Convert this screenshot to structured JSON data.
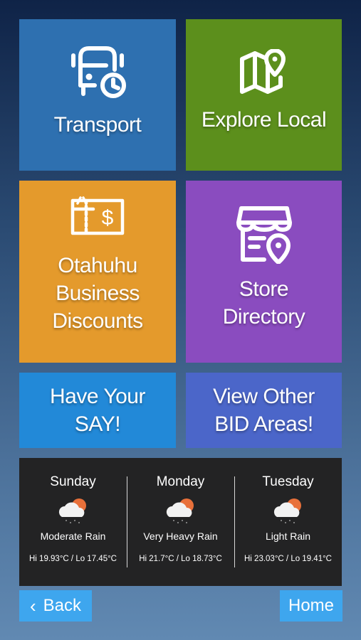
{
  "tiles": {
    "transport": {
      "label": "Transport",
      "color": "#2e70b0",
      "icon": "bus-clock-icon"
    },
    "explore": {
      "label": "Explore Local",
      "color": "#5c8f1c",
      "icon": "map-pin-icon"
    },
    "discounts": {
      "label": "Otahuhu\nBusiness\nDiscounts",
      "color": "#e49a2c",
      "icon": "voucher-dollar-icon"
    },
    "store": {
      "label": "Store\nDirectory",
      "color": "#8a4cbf",
      "icon": "store-pin-icon"
    },
    "say": {
      "label": "Have Your\nSAY!",
      "color": "#2289d8"
    },
    "bid": {
      "label": "View Other\nBID Areas!",
      "color": "#4b66c9"
    }
  },
  "weather": {
    "days": [
      {
        "name": "Sunday",
        "condition": "Moderate Rain",
        "temps": "Hi 19.93°C / Lo 17.45°C",
        "icon": "sun-cloud-rain-icon"
      },
      {
        "name": "Monday",
        "condition": "Very Heavy Rain",
        "temps": "Hi 21.7°C / Lo 18.73°C",
        "icon": "sun-cloud-rain-icon"
      },
      {
        "name": "Tuesday",
        "condition": "Light Rain",
        "temps": "Hi 23.03°C / Lo 19.41°C",
        "icon": "sun-cloud-rain-icon"
      }
    ]
  },
  "nav": {
    "back_icon": "‹",
    "back_label": "Back",
    "home_label": "Home"
  }
}
